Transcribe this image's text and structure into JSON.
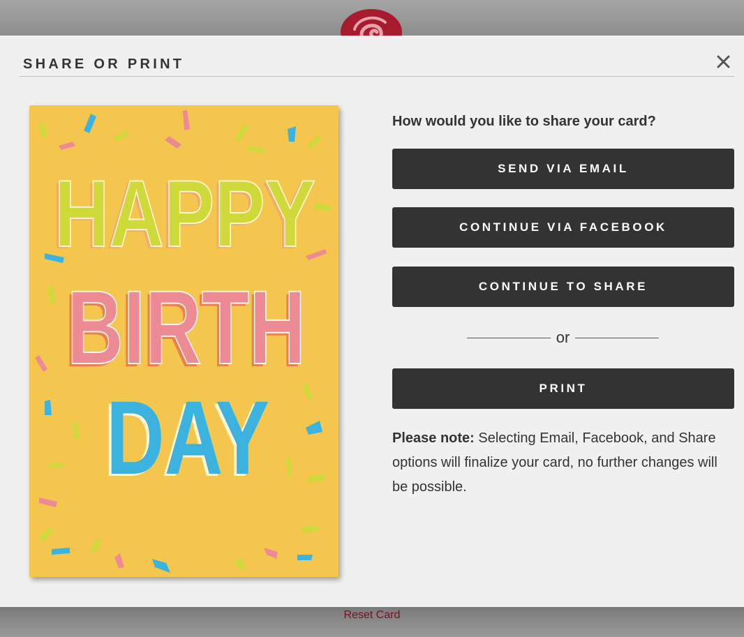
{
  "modal": {
    "title": "SHARE OR PRINT",
    "close_icon": "close-icon"
  },
  "share": {
    "question": "How would you like to share your card?",
    "email_label": "SEND VIA EMAIL",
    "facebook_label": "CONTINUE VIA FACEBOOK",
    "share_label": "CONTINUE TO SHARE",
    "or_text": "or",
    "print_label": "PRINT"
  },
  "note": {
    "label": "Please note:",
    "text": " Selecting Email, Facebook, and Share options will finalize your card, no further changes will be possible."
  },
  "card": {
    "line1": "HAPPY",
    "line2": "BIRTH",
    "line3": "DAY"
  },
  "footer": {
    "reset_label": "Reset Card"
  },
  "colors": {
    "accent": "#8b1a2b",
    "button_bg": "#333333",
    "card_bg": "#f4c64e",
    "happy_color": "#cfd93a",
    "birth_color": "#ec8b94",
    "day_color": "#3bb3de"
  }
}
